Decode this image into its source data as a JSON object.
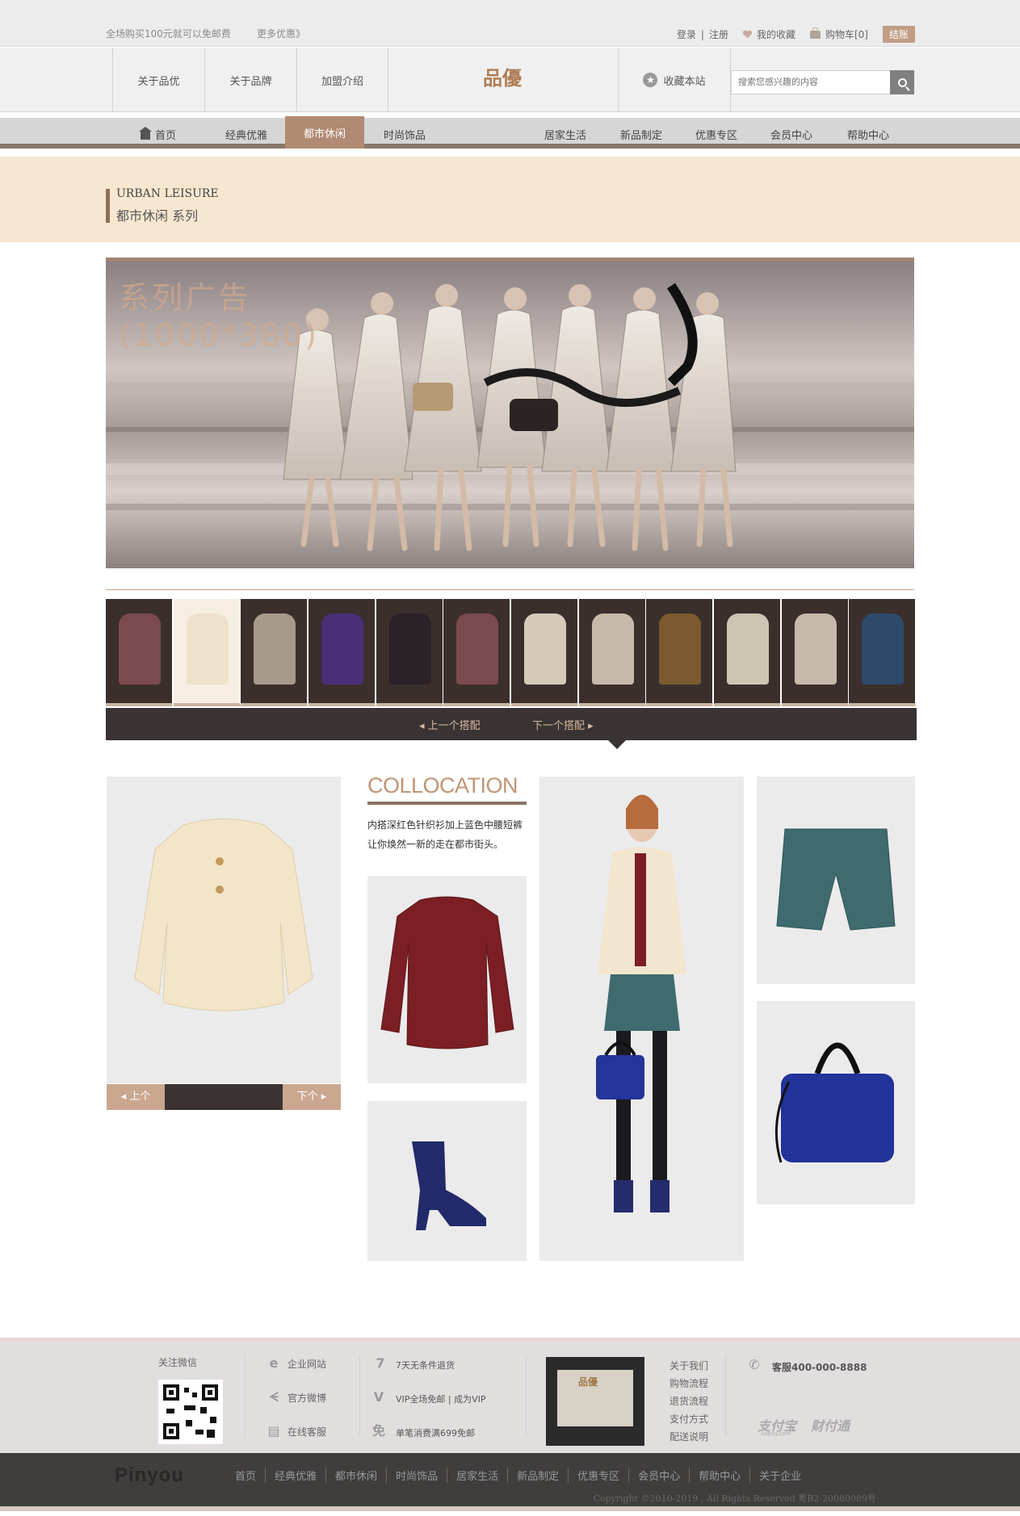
{
  "topbar": {
    "promo": "全场购买100元就可以免邮费",
    "more": "更多优惠》",
    "login": "登录",
    "register": "注册",
    "favorites": "我的收藏",
    "cart": "购物车[0]",
    "checkout": "结账"
  },
  "header": {
    "nav": [
      "关于品优",
      "关于品牌",
      "加盟介绍"
    ],
    "logo": "品優",
    "bookmark": "收藏本站",
    "search_placeholder": "搜索您感兴趣的内容"
  },
  "mainnav": {
    "items": [
      "首页",
      "经典优雅",
      "都市休闲",
      "时尚饰品",
      "居家生活",
      "新品制定",
      "优惠专区",
      "会员中心",
      "帮助中心"
    ],
    "active": "都市休闲"
  },
  "section": {
    "en": "URBAN LEISURE",
    "cn": "都市休闲 系列"
  },
  "ad": {
    "line1": "系列广告",
    "line2": "(1000*380)"
  },
  "thumbnails": [
    {
      "color": "#7a4a4e"
    },
    {
      "color": "#efe2cc"
    },
    {
      "color": "#a89a8a"
    },
    {
      "color": "#4a2e78"
    },
    {
      "color": "#2a2228"
    },
    {
      "color": "#7a4a4e"
    },
    {
      "color": "#d6cbb8"
    },
    {
      "color": "#c7b9a9"
    },
    {
      "color": "#7a5a2e"
    },
    {
      "color": "#cfc5b3"
    },
    {
      "color": "#c7b9a9"
    },
    {
      "color": "#2e4a6a"
    }
  ],
  "pager": {
    "prev": "上一个搭配",
    "next": "下一个搭配"
  },
  "collocation": {
    "title": "COLLOCATION",
    "desc": "内搭深红色针织衫加上蓝色中腰短裤让你焕然一新的走在都市街头。",
    "prev": "上个",
    "next": "下个"
  },
  "footer": {
    "wechat": "关注微信",
    "links1": [
      "企业网站",
      "官方微博",
      "在线客服"
    ],
    "services": [
      "7天无条件退货",
      "VIP全场免邮 | 成为VIP",
      "单笔消费满699免邮"
    ],
    "links2": [
      "关于我们",
      "购物流程",
      "退货流程",
      "支付方式",
      "配送说明"
    ],
    "phone": "客服400-000-8888",
    "pay1": "支付宝",
    "pay1_sub": "Alipay.com",
    "pay2": "财付通"
  },
  "bottombar": {
    "brand": "Pinyou",
    "links": [
      "首页",
      "经典优雅",
      "都市休闲",
      "时尚饰品",
      "居家生活",
      "新品制定",
      "优惠专区",
      "会员中心",
      "帮助中心",
      "关于企业"
    ],
    "copyright": "Copyright ©2010-2019 , All Rights Reserved 粤B2-20080089号"
  }
}
